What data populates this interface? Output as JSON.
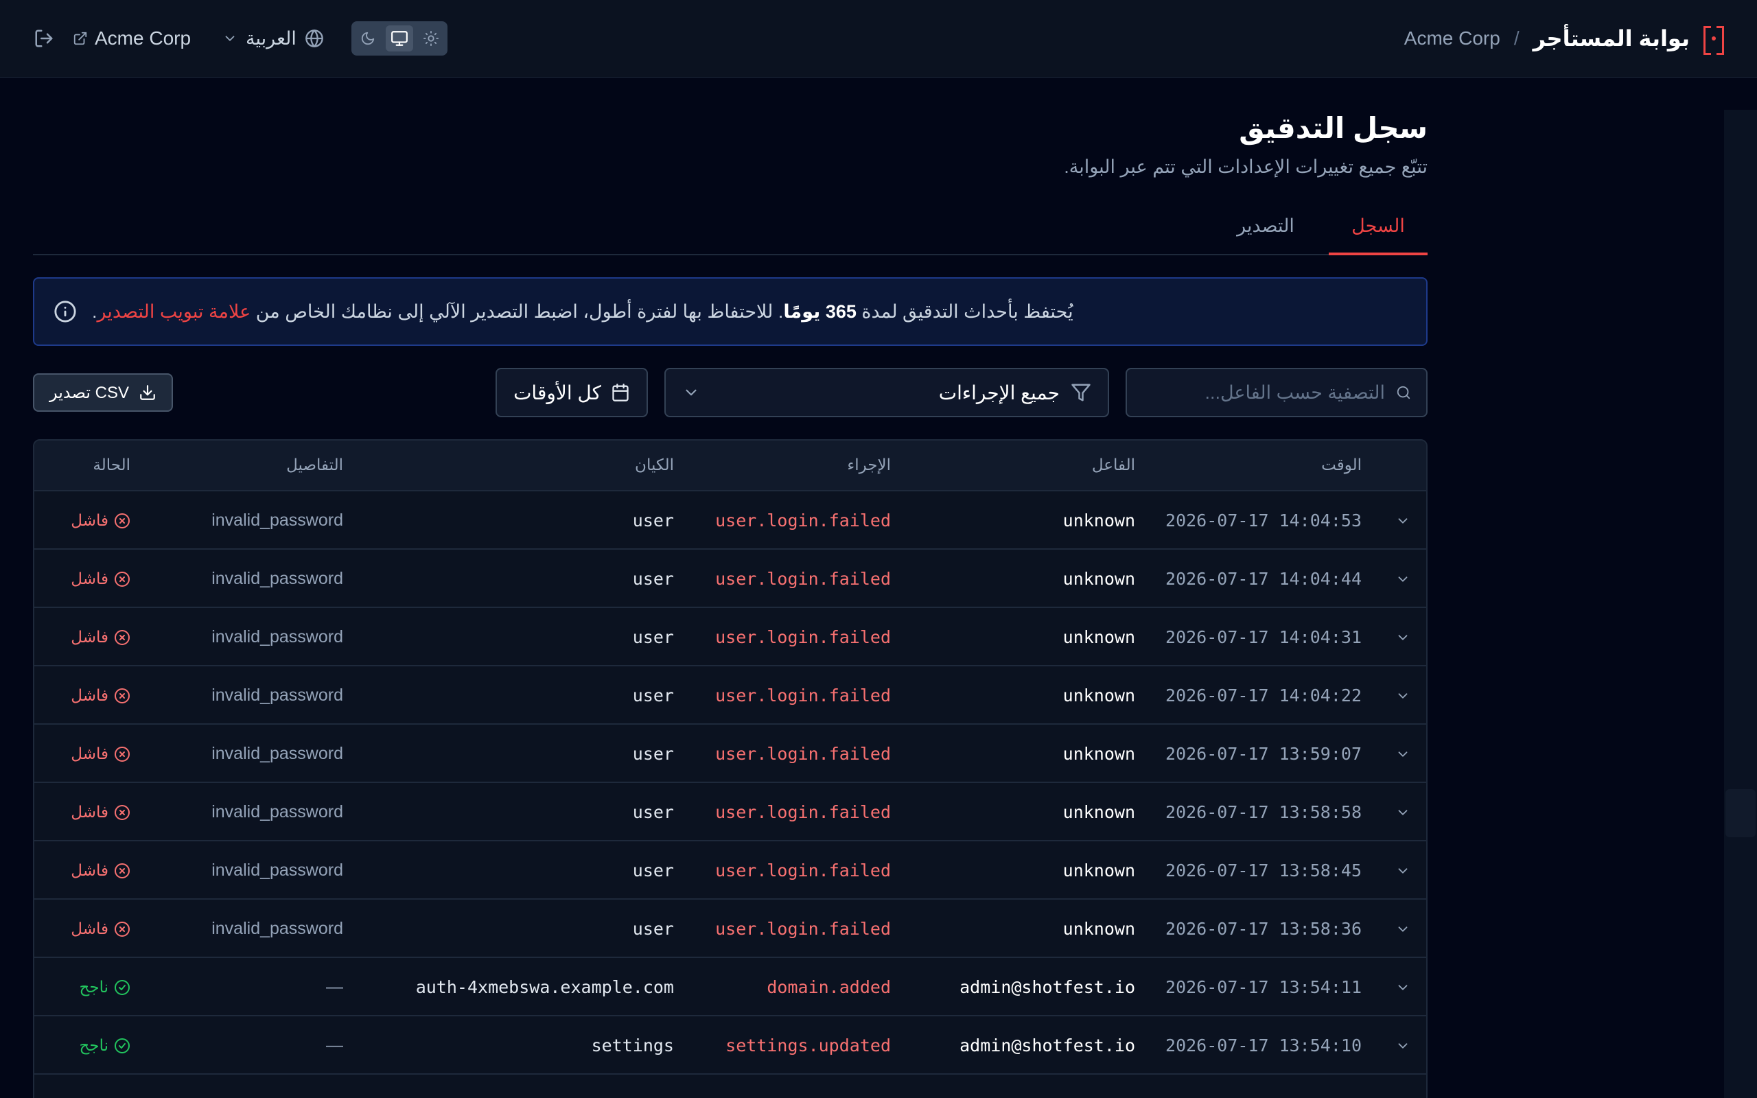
{
  "topbar": {
    "app_title": "بوابة المستأجر",
    "separator": "/",
    "tenant": "Acme Corp",
    "tenant_link": "Acme Corp",
    "language": "العربية"
  },
  "page": {
    "title": "سجل التدقيق",
    "subtitle": "تتبّع جميع تغييرات الإعدادات التي تتم عبر البوابة."
  },
  "tabs": [
    {
      "label": "السجل",
      "active": true
    },
    {
      "label": "التصدير",
      "active": false
    }
  ],
  "banner": {
    "text_before": "يُحتفظ بأحداث التدقيق لمدة",
    "highlight": "365 يومًا",
    "text_after": ". للاحتفاظ بها لفترة أطول، اضبط التصدير الآلي إلى نظامك الخاص من",
    "link": "علامة تبويب التصدير",
    "end": "."
  },
  "filters": {
    "actor_placeholder": "التصفية حسب الفاعل...",
    "action_value": "جميع الإجراءات",
    "time_value": "كل الأوقات",
    "csv_label": "تصدير CSV"
  },
  "table": {
    "headers": {
      "time": "الوقت",
      "actor": "الفاعل",
      "action": "الإجراء",
      "entity": "الكيان",
      "details": "التفاصيل",
      "status": "الحالة"
    },
    "rows": [
      {
        "time": "2026-07-17 14:04:53",
        "actor": "unknown",
        "action": "user.login.failed",
        "entity": "user",
        "details": "invalid_password",
        "status": "فاشل",
        "ok": false
      },
      {
        "time": "2026-07-17 14:04:44",
        "actor": "unknown",
        "action": "user.login.failed",
        "entity": "user",
        "details": "invalid_password",
        "status": "فاشل",
        "ok": false
      },
      {
        "time": "2026-07-17 14:04:31",
        "actor": "unknown",
        "action": "user.login.failed",
        "entity": "user",
        "details": "invalid_password",
        "status": "فاشل",
        "ok": false
      },
      {
        "time": "2026-07-17 14:04:22",
        "actor": "unknown",
        "action": "user.login.failed",
        "entity": "user",
        "details": "invalid_password",
        "status": "فاشل",
        "ok": false
      },
      {
        "time": "2026-07-17 13:59:07",
        "actor": "unknown",
        "action": "user.login.failed",
        "entity": "user",
        "details": "invalid_password",
        "status": "فاشل",
        "ok": false
      },
      {
        "time": "2026-07-17 13:58:58",
        "actor": "unknown",
        "action": "user.login.failed",
        "entity": "user",
        "details": "invalid_password",
        "status": "فاشل",
        "ok": false
      },
      {
        "time": "2026-07-17 13:58:45",
        "actor": "unknown",
        "action": "user.login.failed",
        "entity": "user",
        "details": "invalid_password",
        "status": "فاشل",
        "ok": false
      },
      {
        "time": "2026-07-17 13:58:36",
        "actor": "unknown",
        "action": "user.login.failed",
        "entity": "user",
        "details": "invalid_password",
        "status": "فاشل",
        "ok": false
      },
      {
        "time": "2026-07-17 13:54:11",
        "actor": "admin@shotfest.io",
        "action": "domain.added",
        "entity": "…in:auth-4xmebswa.example.com",
        "details": "—",
        "status": "ناجح",
        "ok": true
      },
      {
        "time": "2026-07-17 13:54:10",
        "actor": "admin@shotfest.io",
        "action": "settings.updated",
        "entity": "settings",
        "details": "—",
        "status": "ناجح",
        "ok": true
      }
    ]
  },
  "colors": {
    "accent": "#ef4444",
    "success": "#22c55e",
    "failure": "#f87171",
    "background": "#020617"
  },
  "icons": {
    "logout": "logout-icon",
    "external": "external-link-icon",
    "chevron": "chevron-down-icon",
    "globe": "globe-icon",
    "moon": "moon-icon",
    "monitor": "monitor-icon",
    "sun": "sun-icon",
    "info": "info-icon",
    "search": "search-icon",
    "filter": "filter-icon",
    "calendar": "calendar-icon",
    "download": "download-icon",
    "fail": "x-circle-icon",
    "ok": "check-circle-icon"
  }
}
